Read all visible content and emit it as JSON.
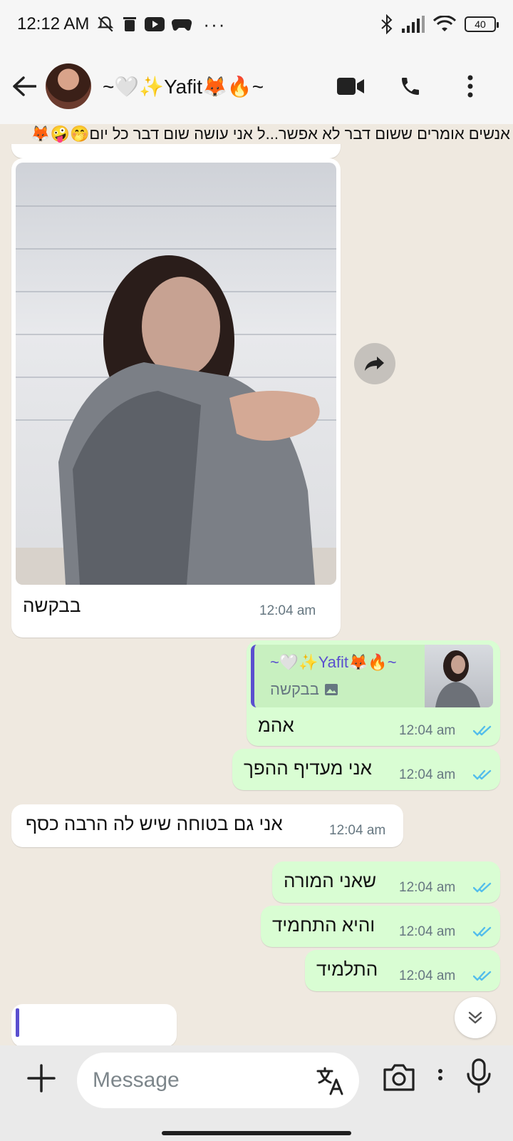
{
  "status_bar": {
    "time": "12:12 AM",
    "overflow": "···",
    "battery": "40"
  },
  "header": {
    "contact_name": "~🤍✨Yafit🦊🔥~"
  },
  "marquee": {
    "text": "אנשים אומרים ששום דבר לא אפשר...ל אני עושה שום דבר כל יום🤭🤪🦊"
  },
  "messages": [
    {
      "id": "m1",
      "direction": "in",
      "type": "image",
      "caption": "בבקשה",
      "time": "12:04 am"
    },
    {
      "id": "m2",
      "direction": "out",
      "quote_name": "~🤍✨Yafit🦊🔥~",
      "quote_caption": "בבקשה",
      "text": "אהמ",
      "time": "12:04 am",
      "status": "read"
    },
    {
      "id": "m3",
      "direction": "out",
      "text": "אני מעדיף ההפך",
      "time": "12:04 am",
      "status": "read"
    },
    {
      "id": "m4",
      "direction": "in",
      "text": "אני גם בטוחה שיש לה הרבה כסף",
      "time": "12:04 am"
    },
    {
      "id": "m5",
      "direction": "out",
      "text": "שאני המורה",
      "time": "12:04 am",
      "status": "read"
    },
    {
      "id": "m6",
      "direction": "out",
      "text": "והיא התחמיד",
      "time": "12:04 am",
      "status": "read"
    },
    {
      "id": "m7",
      "direction": "out",
      "text": "התלמיד",
      "time": "12:04 am",
      "status": "read"
    }
  ],
  "composer": {
    "placeholder": "Message"
  },
  "colors": {
    "incoming_bubble": "#ffffff",
    "outgoing_bubble": "#d9fdd3",
    "read_tick": "#53bdeb",
    "quote_accent": "#5a4fcf"
  }
}
